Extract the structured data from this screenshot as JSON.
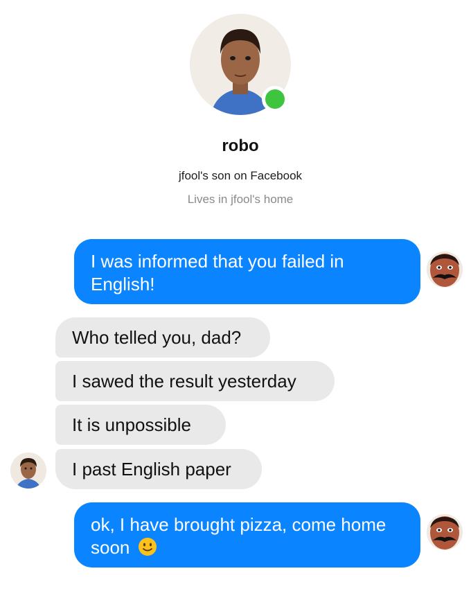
{
  "profile": {
    "name": "robo",
    "subtitle": "jfool's son on Facebook",
    "lives": "Lives in jfool's home",
    "online": true
  },
  "messages": [
    {
      "sender": "dad",
      "text": "I was informed that you failed in English!"
    },
    {
      "sender": "son",
      "text": "Who telled you, dad?"
    },
    {
      "sender": "son",
      "text": "I sawed the result yesterday"
    },
    {
      "sender": "son",
      "text": "It is unpossible"
    },
    {
      "sender": "son",
      "text": "I past English paper"
    },
    {
      "sender": "dad",
      "text": "ok, I have brought pizza, come home soon",
      "emoji": "slightly-smiling-face-icon"
    }
  ],
  "colors": {
    "sent_bubble": "#0a84ff",
    "received_bubble": "#e9e9e9",
    "online": "#3fc43f"
  }
}
